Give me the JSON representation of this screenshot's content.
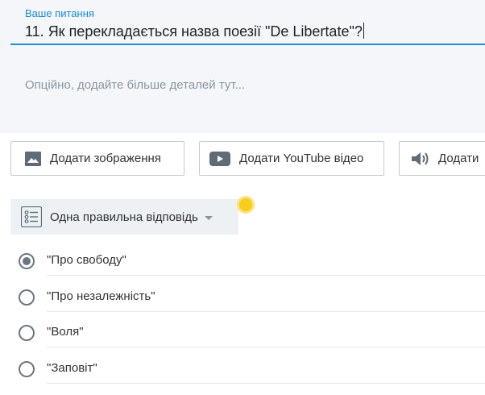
{
  "question": {
    "label": "Ваше питання",
    "text": "11. Як перекладається назва поезії \"De Libertate\"?",
    "details_placeholder": "Опційно, додайте більше деталей тут..."
  },
  "media_buttons": {
    "image": "Додати зображення",
    "youtube": "Додати YouTube відео",
    "audio": "Додати"
  },
  "answer_type": {
    "selected": "Одна правильна відповідь"
  },
  "answers": [
    {
      "text": "\"Про свободу\"",
      "checked": true
    },
    {
      "text": "\"Про незалежність\"",
      "checked": false
    },
    {
      "text": "\"Воля\"",
      "checked": false
    },
    {
      "text": "\"Заповіт\"",
      "checked": false
    }
  ],
  "colors": {
    "accent": "#1e8fd8",
    "highlight": "#f7cd1a"
  }
}
